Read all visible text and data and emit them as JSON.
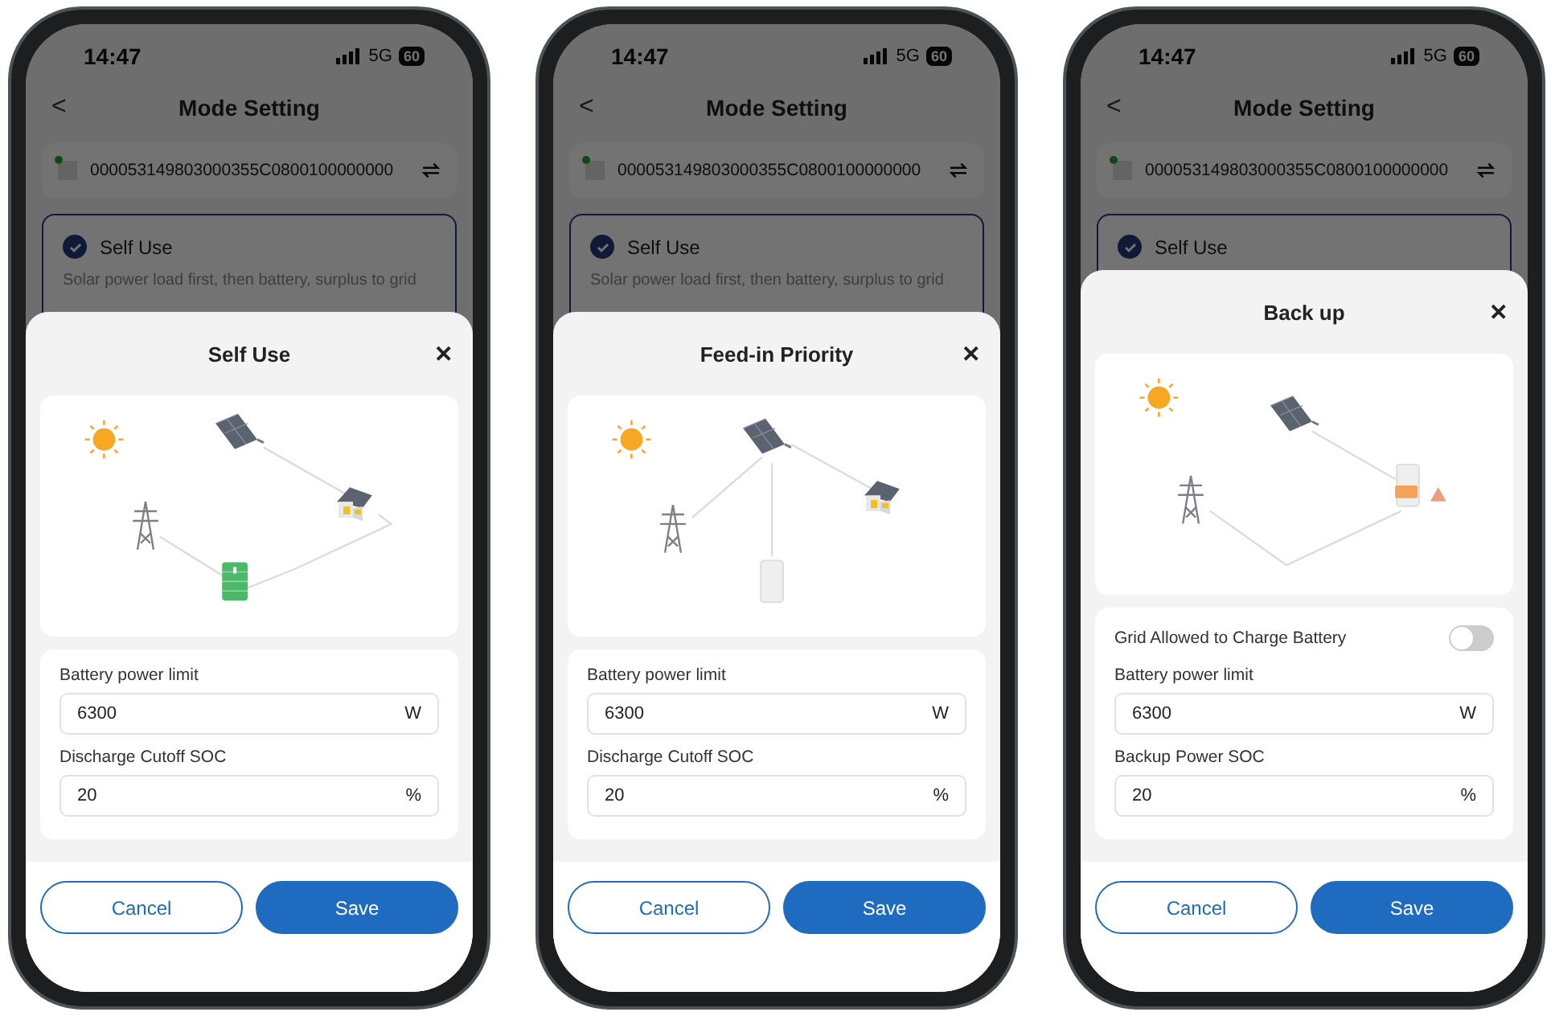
{
  "phones": [
    {
      "status": {
        "time": "14:47",
        "network": "5G",
        "battery": "60"
      },
      "header": {
        "back": "<",
        "title": "Mode Setting"
      },
      "device": {
        "serial": "000053149803000355C0800100000000",
        "online": true
      },
      "mode_card": {
        "title": "Self Use",
        "description": "Solar power load first, then battery, surplus to grid",
        "checked": true
      },
      "sheet": {
        "title": "Self Use",
        "close": "✕",
        "diagram": {
          "kind": "self_use"
        },
        "fields": [
          {
            "label": "Battery power limit",
            "value": "6300",
            "unit": "W"
          },
          {
            "label": "Discharge Cutoff SOC",
            "value": "20",
            "unit": "%"
          }
        ],
        "buttons": [
          {
            "label": "Cancel",
            "kind": "secondary"
          },
          {
            "label": "Save",
            "kind": "primary"
          }
        ]
      }
    },
    {
      "status": {
        "time": "14:47",
        "network": "5G",
        "battery": "60"
      },
      "header": {
        "back": "<",
        "title": "Mode Setting"
      },
      "device": {
        "serial": "000053149803000355C0800100000000",
        "online": true
      },
      "mode_card": {
        "title": "Self Use",
        "description": "Solar power load first, then battery, surplus to grid",
        "checked": true
      },
      "sheet": {
        "title": "Feed-in Priority",
        "close": "✕",
        "diagram": {
          "kind": "feed_in"
        },
        "fields": [
          {
            "label": "Battery power limit",
            "value": "6300",
            "unit": "W"
          },
          {
            "label": "Discharge Cutoff SOC",
            "value": "20",
            "unit": "%"
          }
        ],
        "buttons": [
          {
            "label": "Cancel",
            "kind": "secondary"
          },
          {
            "label": "Save",
            "kind": "primary"
          }
        ]
      }
    },
    {
      "status": {
        "time": "14:47",
        "network": "5G",
        "battery": "60"
      },
      "header": {
        "back": "<",
        "title": "Mode Setting"
      },
      "device": {
        "serial": "000053149803000355C0800100000000",
        "online": true
      },
      "mode_card": {
        "title": "Self Use",
        "checked": true
      },
      "sheet": {
        "title": "Back up",
        "close": "✕",
        "diagram": {
          "kind": "backup"
        },
        "toggle": {
          "label": "Grid Allowed to Charge Battery",
          "on": false
        },
        "fields": [
          {
            "label": "Battery power limit",
            "value": "6300",
            "unit": "W"
          },
          {
            "label": "Backup Power SOC",
            "value": "20",
            "unit": "%"
          }
        ],
        "buttons": [
          {
            "label": "Cancel",
            "kind": "secondary"
          },
          {
            "label": "Save",
            "kind": "primary"
          }
        ]
      }
    }
  ]
}
